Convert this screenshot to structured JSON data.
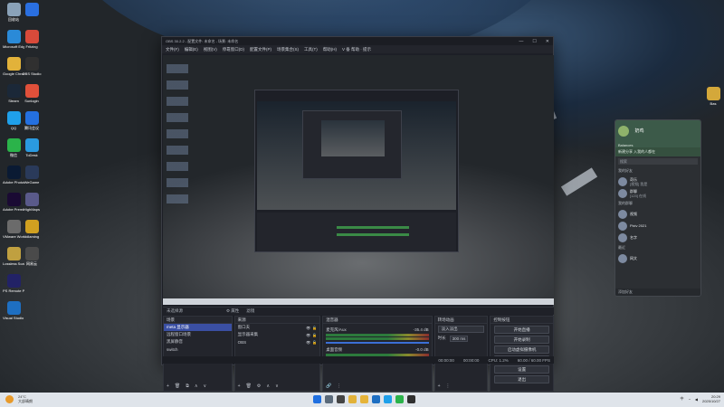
{
  "desktop": {
    "left_icons": [
      {
        "label": "回收站",
        "color": "#8aa2b8"
      },
      {
        "label": "Microsoft Edge",
        "color": "#2a8ad8"
      },
      {
        "label": "Google Chrome",
        "color": "#e2b23a"
      },
      {
        "label": "Steam",
        "color": "#1b2838"
      },
      {
        "label": "QQ",
        "color": "#1fa0ea"
      },
      {
        "label": "微信",
        "color": "#2bb34a"
      },
      {
        "label": "Adobe Photosh...",
        "color": "#0a1a33"
      },
      {
        "label": "Adobe Premie...",
        "color": "#1a0a33"
      },
      {
        "label": "VMware Workstation",
        "color": "#6b6b6b"
      },
      {
        "label": "Lossless Scaling",
        "color": "#c0a040"
      },
      {
        "label": "PS Remote Play",
        "color": "#222266"
      },
      {
        "label": "Visual Studio Code",
        "color": "#1e6fc2"
      }
    ],
    "right_col_icons": [
      {
        "label": "",
        "color": "#2a6fe0"
      },
      {
        "label": "Fritzing",
        "color": "#d84a3a"
      },
      {
        "label": "OBS Studio",
        "color": "#303030"
      },
      {
        "label": "Sunlogin",
        "color": "#e0503a"
      },
      {
        "label": "腾讯会议",
        "color": "#2470e0"
      },
      {
        "label": "ToDesk",
        "color": "#2a9ae0"
      },
      {
        "label": "WeGame",
        "color": "#2a3a5a"
      },
      {
        "label": "HighMaps",
        "color": "#5a5a8a"
      },
      {
        "label": "ddlaming",
        "color": "#d0a020"
      },
      {
        "label": "网易云",
        "color": "#4a4a4a"
      }
    ],
    "far_right_icon": {
      "label": "Bas",
      "color": "#d4a83a"
    }
  },
  "obs": {
    "title": "OBS 30.2.2 - 配置文件: 未命名 - 场景: 未命名",
    "window_controls": [
      "—",
      "☐",
      "✕"
    ],
    "menu": [
      "文件(F)",
      "编辑(E)",
      "视图(V)",
      "停靠窗口(D)",
      "配置文件(P)",
      "场景集合(S)",
      "工具(T)",
      "帮助(H)",
      "V 备 帮助 · 提示"
    ],
    "toolbar": {
      "source_name": "未选择源",
      "properties": "⚙ 属性",
      "filters": "滤镜"
    },
    "scenes": {
      "header": "场景",
      "items": [
        "meta 显示器",
        "远程窗口场景",
        "黑屏静音",
        "switch"
      ],
      "selected": 0,
      "footer": [
        "+",
        "🗑",
        "⧉",
        "∧",
        "∨"
      ]
    },
    "sources": {
      "header": "来源",
      "items": [
        "窗口夫",
        "显示器采集",
        "OBS"
      ],
      "footer": [
        "+",
        "🗑",
        "⚙",
        "∧",
        "∨"
      ]
    },
    "mixer": {
      "header": "混音器",
      "tracks": [
        {
          "name": "麦克风/Aux",
          "db": "-35.4 dB"
        },
        {
          "name": "桌面音频",
          "db": "-0.0 dB"
        }
      ],
      "footer": [
        "🔗",
        "⋮"
      ]
    },
    "transitions": {
      "header": "转场动画",
      "type": "淡入淡出",
      "duration_label": "时长",
      "duration": "300 ms",
      "footer": [
        "+",
        "⋮"
      ]
    },
    "controls": {
      "header": "控制按钮",
      "buttons": [
        "开始直播",
        "开始录制",
        "启动虚拟摄像机",
        "工作室模式",
        "设置",
        "退出"
      ]
    },
    "status": {
      "live": "00:00:00",
      "rec": "00:00:00",
      "cpu": "CPU: 1.2%",
      "fps": "60.00 / 60.00 FPS"
    }
  },
  "qq": {
    "name": "奶鸡",
    "signature": "Balances",
    "banner": "新建分享 入我的人都在",
    "search_placeholder": "搜索",
    "groups": [
      {
        "title": "我的好友",
        "items": [
          {
            "name": "奇乐",
            "sub": "[视频] 我是"
          },
          {
            "name": "群聊",
            "sub": "[123] 在线"
          }
        ]
      },
      {
        "title": "我的群聊",
        "items": [
          {
            "name": "视频",
            "sub": ""
          },
          {
            "name": "Pixiv 2021",
            "sub": ""
          },
          {
            "name": "名字",
            "sub": ""
          }
        ]
      },
      {
        "title": "最近",
        "items": [
          {
            "name": "网文",
            "sub": ""
          }
        ]
      }
    ],
    "footer": "添加好友"
  },
  "taskbar": {
    "weather_temp": "24°C",
    "weather_desc": "大部晴朗",
    "center_icons": [
      {
        "name": "windows-start-icon",
        "color": "#1f6fe0"
      },
      {
        "name": "search-icon",
        "color": "#5a6a7a"
      },
      {
        "name": "task-view-icon",
        "color": "#444"
      },
      {
        "name": "chrome-icon",
        "color": "#e2b23a"
      },
      {
        "name": "file-explorer-icon",
        "color": "#e6b43a"
      },
      {
        "name": "vscode-icon",
        "color": "#1e6fc2"
      },
      {
        "name": "qq-icon",
        "color": "#1fa0ea"
      },
      {
        "name": "wechat-icon",
        "color": "#2bb34a"
      },
      {
        "name": "obs-icon",
        "color": "#303030"
      }
    ],
    "ime": "中",
    "time": "20:29",
    "date": "2025/10/27"
  }
}
